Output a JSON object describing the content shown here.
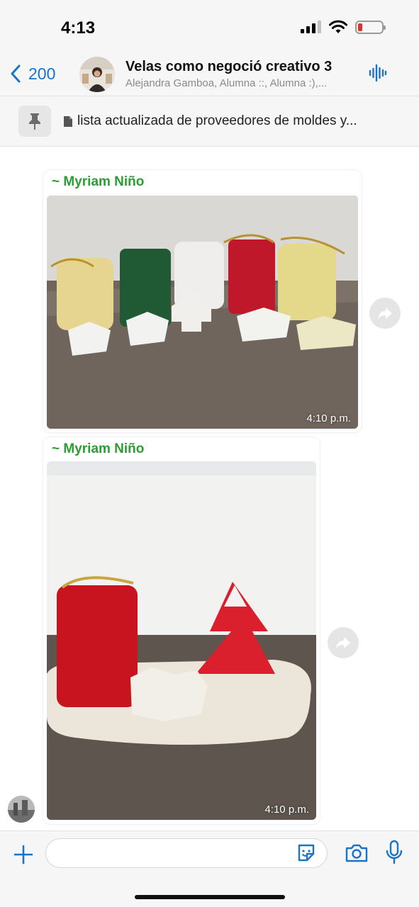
{
  "status_bar": {
    "time": "4:13",
    "battery_color": "#e0312f"
  },
  "header": {
    "back_count": "200",
    "title": "Velas como negoció creativo 3",
    "subtitle": "Alejandra Gamboa, Alumna ::, Alumna :),..."
  },
  "pinned": {
    "text": "lista actualizada  de proveedores de moldes y..."
  },
  "messages": [
    {
      "sender": "~ Myriam Niño",
      "time": "4:10 p.m.",
      "icon": "forward-icon"
    },
    {
      "sender": "~ Myriam Niño",
      "time": "4:10 p.m.",
      "icon": "forward-icon"
    }
  ],
  "composer": {
    "placeholder": ""
  },
  "colors": {
    "accent": "#1a73c8",
    "sender_name": "#2e9c35",
    "bar_background": "#f6f6f6"
  }
}
